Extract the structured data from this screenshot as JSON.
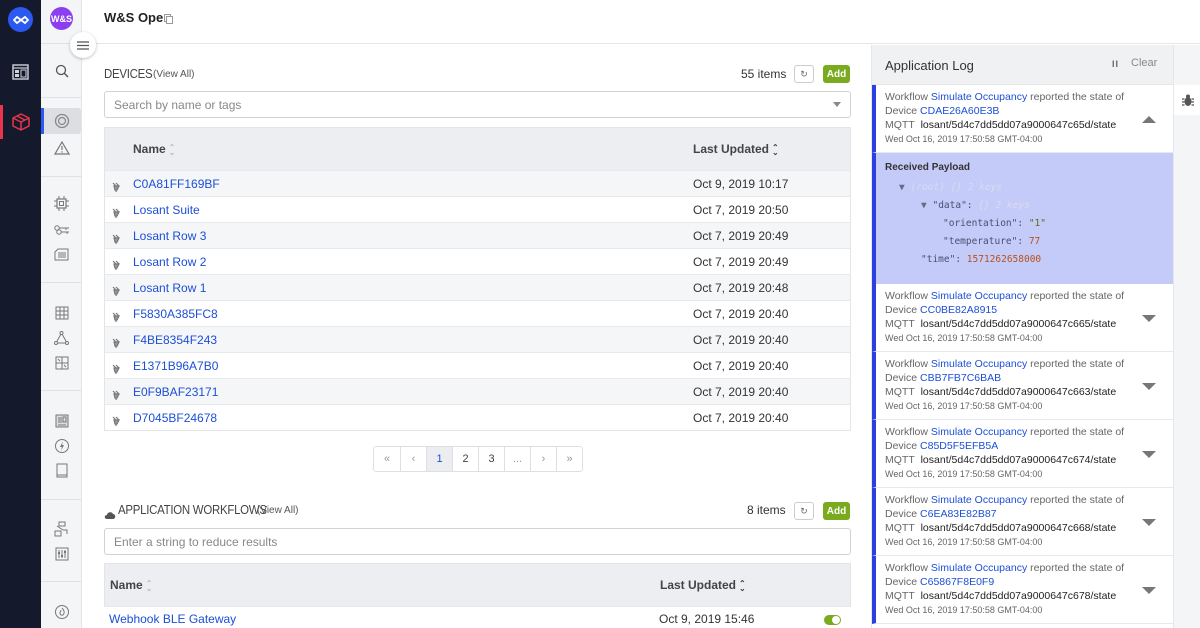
{
  "app": {
    "title": "W&S Open",
    "avatar_text": "W&S"
  },
  "rail": {
    "items": [
      "logo-icon",
      "dashboard-icon",
      "applications-icon"
    ]
  },
  "sidebar": {
    "items": [
      "search-icon",
      "overview-icon",
      "alerts-icon",
      "devices-icon",
      "access-keys-icon",
      "edge-compute-icon",
      "data-tables-icon",
      "workflows-icon",
      "experiences-icon",
      "dashboards-icon",
      "notebooks-icon",
      "files-icon",
      "integrations-icon",
      "settings-icon",
      "resources-icon"
    ]
  },
  "devices": {
    "title": "DEVICES",
    "view_all": "(View All)",
    "count": "55 items",
    "add_label": "Add",
    "refresh_label": "↻",
    "search_placeholder": "Search by name or tags",
    "columns": {
      "name": "Name",
      "updated": "Last Updated"
    },
    "rows": [
      {
        "name": "C0A81FF169BF",
        "updated": "Oct 9, 2019 10:17"
      },
      {
        "name": "Losant Suite",
        "updated": "Oct 7, 2019 20:50"
      },
      {
        "name": "Losant Row 3",
        "updated": "Oct 7, 2019 20:49"
      },
      {
        "name": "Losant Row 2",
        "updated": "Oct 7, 2019 20:49"
      },
      {
        "name": "Losant Row 1",
        "updated": "Oct 7, 2019 20:48"
      },
      {
        "name": "F5830A385FC8",
        "updated": "Oct 7, 2019 20:40"
      },
      {
        "name": "F4BE8354F243",
        "updated": "Oct 7, 2019 20:40"
      },
      {
        "name": "E1371B96A7B0",
        "updated": "Oct 7, 2019 20:40"
      },
      {
        "name": "E0F9BAF23171",
        "updated": "Oct 7, 2019 20:40"
      },
      {
        "name": "D7045BF24678",
        "updated": "Oct 7, 2019 20:40"
      }
    ],
    "pagination": {
      "pages": [
        "«",
        "‹",
        "1",
        "2",
        "3",
        "...",
        "›",
        "»"
      ],
      "current": "1"
    }
  },
  "workflows": {
    "title": "APPLICATION WORKFLOWS",
    "view_all": "(View All)",
    "count": "8 items",
    "add_label": "Add",
    "refresh_label": "↻",
    "search_placeholder": "Enter a string to reduce results",
    "columns": {
      "name": "Name",
      "updated": "Last Updated"
    },
    "rows": [
      {
        "name": "Webhook BLE Gateway",
        "updated": "Oct 9, 2019 15:46",
        "enabled": true
      }
    ]
  },
  "log": {
    "title": "Application Log",
    "pause_label": "II",
    "clear_label": "Clear",
    "payload": {
      "heading": "Received Payload",
      "root": "(root)",
      "root_meta": "{}  2 keys",
      "data_key": "\"data\":",
      "data_meta": "{}  2 keys",
      "orientation_key": "\"orientation\":",
      "orientation_val": "\"1\"",
      "temperature_key": "\"temperature\":",
      "temperature_val": "77",
      "time_key": "\"time\":",
      "time_val": "1571262658000"
    },
    "entries": [
      {
        "prefix": "Workflow",
        "workflow": "Simulate Occupancy",
        "middle": "reported the state of",
        "device_prefix": "Device",
        "device": "CDAE26A60E3B",
        "mqtt_label": "MQTT",
        "topic": "losant/5d4c7dd5dd07a9000647c65d/state",
        "time": "Wed Oct 16, 2019 17:50:58 GMT-04:00",
        "expanded": true
      },
      {
        "prefix": "Workflow",
        "workflow": "Simulate Occupancy",
        "middle": "reported the state of",
        "device_prefix": "Device",
        "device": "CC0BE82A8915",
        "mqtt_label": "MQTT",
        "topic": "losant/5d4c7dd5dd07a9000647c665/state",
        "time": "Wed Oct 16, 2019 17:50:58 GMT-04:00",
        "expanded": false
      },
      {
        "prefix": "Workflow",
        "workflow": "Simulate Occupancy",
        "middle": "reported the state of",
        "device_prefix": "Device",
        "device": "CBB7FB7C6BAB",
        "mqtt_label": "MQTT",
        "topic": "losant/5d4c7dd5dd07a9000647c663/state",
        "time": "Wed Oct 16, 2019 17:50:58 GMT-04:00",
        "expanded": false
      },
      {
        "prefix": "Workflow",
        "workflow": "Simulate Occupancy",
        "middle": "reported the state of",
        "device_prefix": "Device",
        "device": "C85D5F5EFB5A",
        "mqtt_label": "MQTT",
        "topic": "losant/5d4c7dd5dd07a9000647c674/state",
        "time": "Wed Oct 16, 2019 17:50:58 GMT-04:00",
        "expanded": false
      },
      {
        "prefix": "Workflow",
        "workflow": "Simulate Occupancy",
        "middle": "reported the state of",
        "device_prefix": "Device",
        "device": "C6EA83E82B87",
        "mqtt_label": "MQTT",
        "topic": "losant/5d4c7dd5dd07a9000647c668/state",
        "time": "Wed Oct 16, 2019 17:50:58 GMT-04:00",
        "expanded": false
      },
      {
        "prefix": "Workflow",
        "workflow": "Simulate Occupancy",
        "middle": "reported the state of",
        "device_prefix": "Device",
        "device": "C65867F8E0F9",
        "mqtt_label": "MQTT",
        "topic": "losant/5d4c7dd5dd07a9000647c678/state",
        "time": "Wed Oct 16, 2019 17:50:58 GMT-04:00",
        "expanded": false
      }
    ]
  },
  "colors": {
    "accent": "#2c59f2",
    "add_green": "#7aab1f",
    "link": "#1d4fd6",
    "rail_bg": "#141a2b",
    "active_red": "#e8344c",
    "payload_bg": "#c5cbf9"
  }
}
